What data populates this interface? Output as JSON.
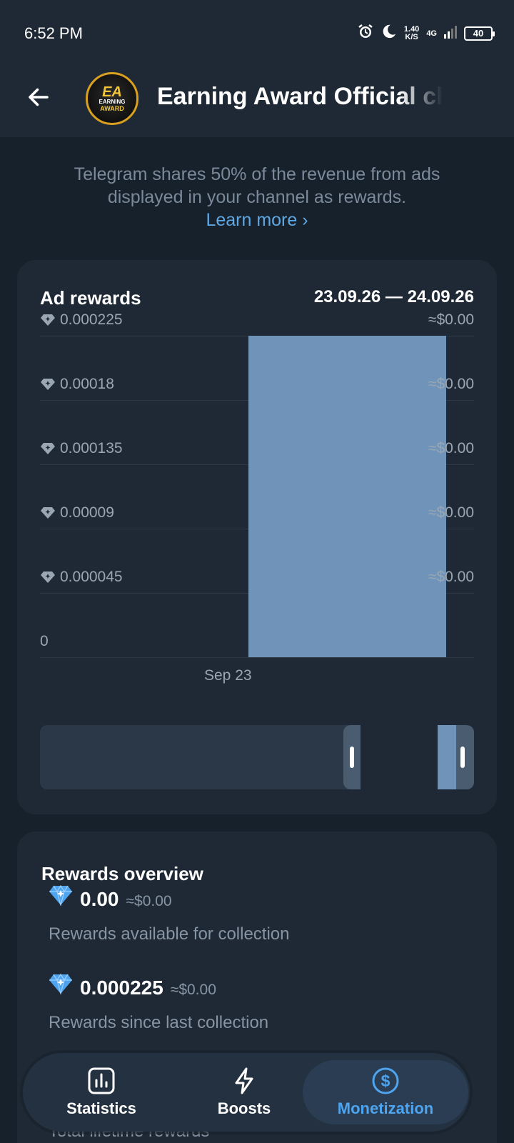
{
  "status_bar": {
    "time": "6:52 PM",
    "speed_value": "1.40",
    "speed_unit": "K/S",
    "network": "4G",
    "battery": "40"
  },
  "header": {
    "channel_title": "Earning Award Official channel",
    "avatar_text": {
      "top": "EA",
      "middle": "EARNING",
      "bottom": "AWARD"
    }
  },
  "intro": {
    "text": "Telegram shares 50% of the revenue from ads displayed in your channel as rewards.",
    "link_label": "Learn more ›"
  },
  "ad_rewards": {
    "title": "Ad rewards",
    "date_range": "23.09.26 — 24.09.26"
  },
  "chart_data": {
    "type": "bar",
    "title": "Ad rewards",
    "categories": [
      "Sep 23"
    ],
    "values": [
      0.000225
    ],
    "ylim": [
      0,
      0.000225
    ],
    "y_ticks": [
      "0.000225",
      "0.00018",
      "0.000135",
      "0.00009",
      "0.000045",
      "0"
    ],
    "y_ticks_right": [
      "≈$0.00",
      "≈$0.00",
      "≈$0.00",
      "≈$0.00",
      "≈$0.00"
    ],
    "bar_color": "#7093b9",
    "grid": true
  },
  "overview": {
    "title": "Rewards overview",
    "items": [
      {
        "amount": "0.00",
        "usd": "≈$0.00",
        "label": "Rewards available for collection"
      },
      {
        "amount": "0.000225",
        "usd": "≈$0.00",
        "label": "Rewards since last collection"
      },
      {
        "label": "Total lifetime rewards"
      }
    ]
  },
  "nav": {
    "statistics": "Statistics",
    "boosts": "Boosts",
    "monetization": "Monetization",
    "active": "monetization"
  },
  "colors": {
    "background": "#17212b",
    "card": "#1e2935",
    "accent": "#4ea4ef",
    "bar": "#7093b9"
  }
}
